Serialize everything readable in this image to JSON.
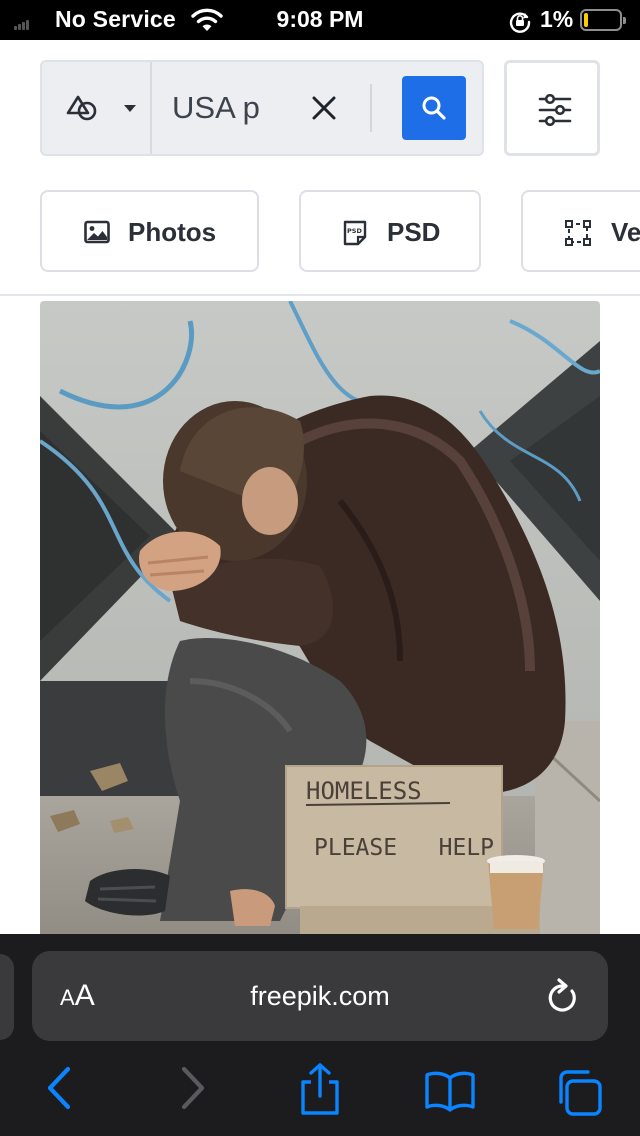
{
  "status_bar": {
    "carrier": "No Service",
    "time": "9:08 PM",
    "battery_percent": "1%",
    "battery_level": 0.01,
    "icons": [
      "signal-icon",
      "wifi-icon",
      "orientation-lock-icon",
      "battery-icon"
    ],
    "battery_color": "#ffcc00"
  },
  "search": {
    "asset_type_icon": "shapes-icon",
    "query": "USA p",
    "clear_icon": "close-icon",
    "submit_icon": "search-icon",
    "submit_color": "#1e6ee8",
    "filters_icon": "sliders-icon"
  },
  "filter_chips": [
    {
      "label": "Photos",
      "icon": "image-icon"
    },
    {
      "label": "PSD",
      "icon": "psd-file-icon"
    },
    {
      "label": "Ve",
      "icon": "vector-icon"
    }
  ],
  "result": {
    "sign_line_1": "HOMELESS",
    "sign_line_2": "PLEASE   HELP"
  },
  "browser": {
    "text_size_small": "A",
    "text_size_large": "A",
    "url": "freepik.com",
    "accent_color": "#0a84ff",
    "toolbar_icons": [
      "back-icon",
      "forward-icon",
      "share-icon",
      "bookmarks-icon",
      "tabs-icon"
    ]
  }
}
